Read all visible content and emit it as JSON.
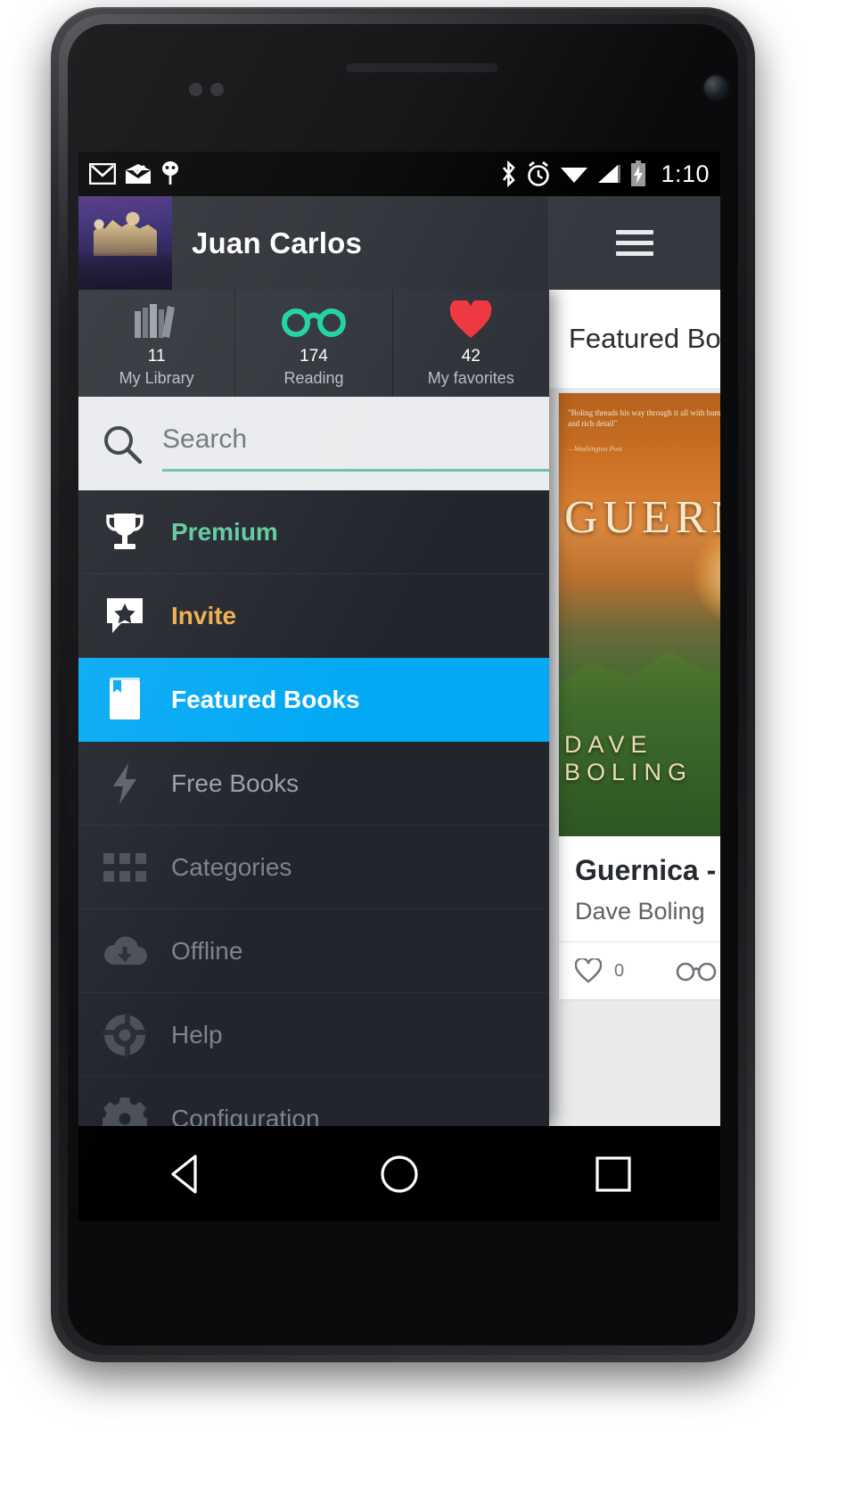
{
  "status_bar": {
    "time": "1:10",
    "left_icons": [
      "gmail-icon",
      "inbox-icon",
      "android-debug-icon"
    ],
    "right_icons": [
      "bluetooth-icon",
      "alarm-icon",
      "wifi-icon",
      "signal-icon",
      "battery-charging-icon"
    ]
  },
  "action_bar": {
    "user_name": "Juan Carlos",
    "avatar": "profile-photo",
    "menu_icon": "hamburger-icon"
  },
  "stats": [
    {
      "icon": "books-icon",
      "count": "11",
      "label": "My Library"
    },
    {
      "icon": "glasses-icon",
      "count": "174",
      "label": "Reading"
    },
    {
      "icon": "heart-icon",
      "count": "42",
      "label": "My favorites"
    }
  ],
  "search": {
    "placeholder": "Search",
    "value": "",
    "icon": "search-icon"
  },
  "drawer_items": [
    {
      "label": "Premium",
      "icon": "trophy-icon",
      "state": "premium"
    },
    {
      "label": "Invite",
      "icon": "star-message-icon",
      "state": "invite"
    },
    {
      "label": "Featured Books",
      "icon": "book-icon",
      "state": "selected"
    },
    {
      "label": "Free Books",
      "icon": "lightning-bolt-icon",
      "state": "muted"
    },
    {
      "label": "Categories",
      "icon": "grid-icon",
      "state": "dim"
    },
    {
      "label": "Offline",
      "icon": "cloud-download-icon",
      "state": "dim"
    },
    {
      "label": "Help",
      "icon": "life-ring-icon",
      "state": "dim"
    },
    {
      "label": "Configuration",
      "icon": "gear-icon",
      "state": "dim"
    }
  ],
  "right_pane": {
    "title": "Featured Books",
    "book": {
      "cover_title": "GUERNICA",
      "cover_author": "DAVE BOLING",
      "cover_blurb": "\"Boling threads his way through it all with humor, compassion and rich detail\"",
      "cover_blurb_source": "—Washington Post",
      "title": "Guernica -",
      "author": "Dave Boling",
      "favorite_count": "0",
      "favorite_icon": "heart-icon",
      "reading_icon": "glasses-icon"
    }
  },
  "system_nav": {
    "back": "back-triangle-icon",
    "home": "home-circle-icon",
    "recents": "recents-square-icon"
  },
  "colors": {
    "accent_blue": "#03a9f4",
    "premium_green": "#5fc9a0",
    "invite_orange": "#f0ad4e",
    "heart_red": "#f0353e",
    "glasses_green": "#19d2a0",
    "search_underline": "#6cc2ac",
    "drawer_bg": "#22262c",
    "action_bar_bg": "#2b2e34"
  }
}
